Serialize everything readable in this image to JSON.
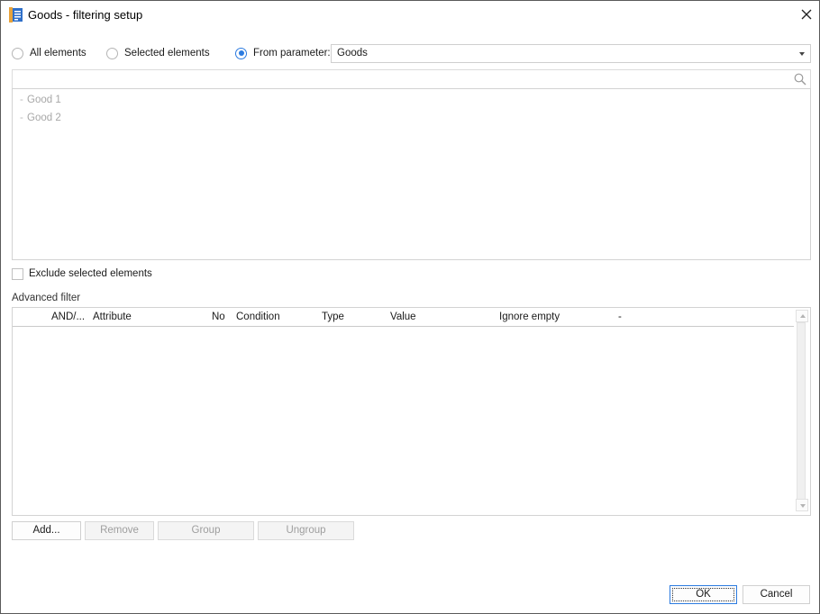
{
  "window": {
    "title": "Goods - filtering setup"
  },
  "selection_mode": {
    "options": [
      {
        "label": "All elements",
        "checked": false
      },
      {
        "label": "Selected elements",
        "checked": false
      },
      {
        "label": "From parameter:",
        "checked": true
      }
    ],
    "parameter_value": "Goods"
  },
  "search": {
    "placeholder": ""
  },
  "tree": {
    "items": [
      {
        "label": "Good 1"
      },
      {
        "label": "Good 2"
      }
    ]
  },
  "exclude": {
    "label": "Exclude selected elements",
    "checked": false
  },
  "advanced_filter": {
    "label": "Advanced filter",
    "columns": [
      "AND/...",
      "Attribute",
      "No",
      "Condition",
      "Type",
      "Value",
      "Ignore empty",
      "-"
    ],
    "rows": []
  },
  "grid_buttons": {
    "add": "Add...",
    "remove": "Remove",
    "group": "Group",
    "ungroup": "Ungroup"
  },
  "dialog_buttons": {
    "ok": "OK",
    "cancel": "Cancel"
  },
  "colors": {
    "accent": "#2c7be0",
    "icon_orange": "#e8a33a",
    "icon_blue": "#2f6fc8"
  }
}
